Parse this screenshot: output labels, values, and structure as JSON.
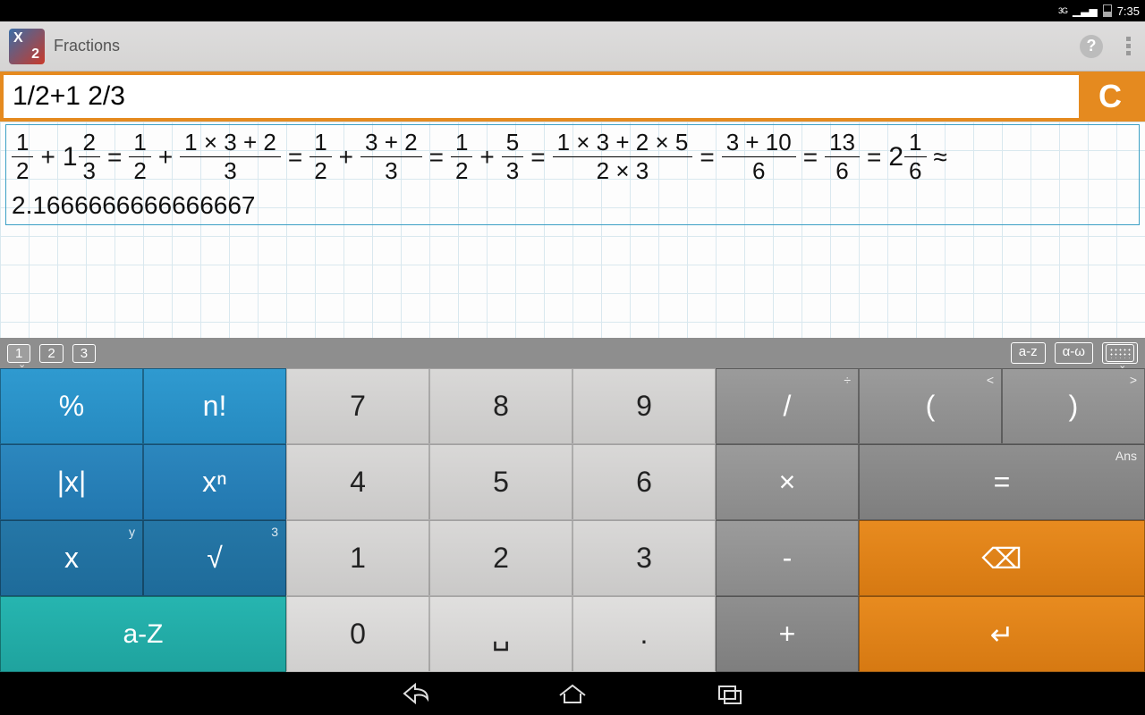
{
  "status": {
    "network": "3G",
    "time": "7:35"
  },
  "app": {
    "title": "Fractions"
  },
  "input": {
    "expression": "1/2+1 2/3",
    "clear_label": "C"
  },
  "result": {
    "steps": [
      {
        "t": "mixed_plus",
        "a": {
          "n": "1",
          "d": "2"
        },
        "w": "1",
        "b": {
          "n": "2",
          "d": "3"
        }
      },
      {
        "t": "eq"
      },
      {
        "t": "frac",
        "n": "1",
        "d": "2"
      },
      {
        "t": "op",
        "v": "+"
      },
      {
        "t": "frac",
        "n": "1 × 3 + 2",
        "d": "3"
      },
      {
        "t": "eq"
      },
      {
        "t": "frac",
        "n": "1",
        "d": "2"
      },
      {
        "t": "op",
        "v": "+"
      },
      {
        "t": "frac",
        "n": "3 + 2",
        "d": "3"
      },
      {
        "t": "eq"
      },
      {
        "t": "frac",
        "n": "1",
        "d": "2"
      },
      {
        "t": "op",
        "v": "+"
      },
      {
        "t": "frac",
        "n": "5",
        "d": "3"
      },
      {
        "t": "eq"
      },
      {
        "t": "frac",
        "n": "1 × 3 + 2 × 5",
        "d": "2 × 3"
      },
      {
        "t": "eq"
      },
      {
        "t": "frac",
        "n": "3 + 10",
        "d": "6"
      },
      {
        "t": "eq"
      },
      {
        "t": "frac",
        "n": "13",
        "d": "6"
      },
      {
        "t": "eq"
      },
      {
        "t": "mixed",
        "w": "2",
        "n": "1",
        "d": "6"
      },
      {
        "t": "op",
        "v": "≈"
      }
    ],
    "decimal": "2.1666666666666667"
  },
  "modetabs": {
    "left": [
      "1",
      "2",
      "3"
    ],
    "right": [
      "a-z",
      "α-ω"
    ]
  },
  "keys": {
    "percent": "%",
    "factorial": "n!",
    "abs": "|x|",
    "power": "xⁿ",
    "var": "x",
    "var_sup": "y",
    "sqrt": "√",
    "sqrt_sup": "3",
    "alpha": "a-Z",
    "d7": "7",
    "d8": "8",
    "d9": "9",
    "d4": "4",
    "d5": "5",
    "d6": "6",
    "d1": "1",
    "d2": "2",
    "d3": "3",
    "d0": "0",
    "space": "␣",
    "dot": ".",
    "divide": "/",
    "divide_sup": "÷",
    "multiply": "×",
    "minus": "-",
    "plus": "+",
    "lparen": "(",
    "lparen_sup": "<",
    "rparen": ")",
    "rparen_sup": ">",
    "equals": "=",
    "equals_sup": "Ans",
    "backspace": "⌫",
    "enter": "↵"
  }
}
